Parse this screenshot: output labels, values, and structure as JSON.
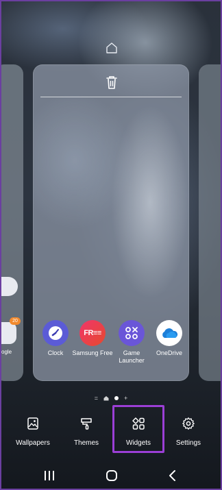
{
  "card": {
    "apps": [
      {
        "label": "Clock",
        "icon": "clock-icon",
        "color": "#5b5bd6"
      },
      {
        "label": "Samsung Free",
        "icon": "samsung-free-icon",
        "color": "#e8325f"
      },
      {
        "label": "Game Launcher",
        "icon": "game-launcher-icon",
        "color": "#6a56d8"
      },
      {
        "label": "OneDrive",
        "icon": "onedrive-icon",
        "color": "#ffffff"
      }
    ],
    "samsung_free_text": "FR≡≡"
  },
  "left_card": {
    "badge": "20",
    "label": "ogle"
  },
  "indicators": {
    "menu": "=",
    "add": "+"
  },
  "toolbar": {
    "items": [
      {
        "label": "Wallpapers",
        "icon": "wallpapers-icon"
      },
      {
        "label": "Themes",
        "icon": "themes-icon"
      },
      {
        "label": "Widgets",
        "icon": "widgets-icon"
      },
      {
        "label": "Settings",
        "icon": "settings-icon"
      }
    ],
    "highlight_color": "#9b3fd6"
  },
  "navbar": {
    "buttons": [
      "recents-icon",
      "home-icon",
      "back-icon"
    ]
  }
}
